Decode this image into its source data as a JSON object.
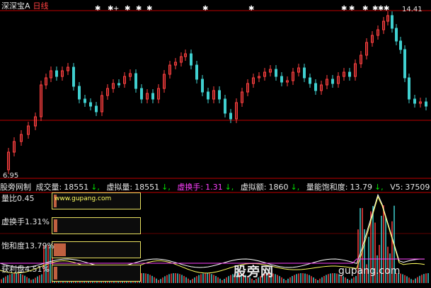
{
  "header": {
    "title": "深深宝A",
    "period": "日线"
  },
  "price": {
    "high_label": "14.41",
    "low_label": "6.95"
  },
  "markers": [
    134,
    152,
    160,
    176,
    192,
    207,
    286,
    351,
    482,
    493,
    512,
    526,
    534,
    542
  ],
  "indicator_bar": {
    "items": [
      {
        "label": "成交量:",
        "value": "18551",
        "arrow": "↓,",
        "color": "white"
      },
      {
        "label": "虚拟量:",
        "value": "18551",
        "arrow": "↓,",
        "color": "white"
      },
      {
        "label": "虚换手:",
        "value": "1.31",
        "arrow": "↓,",
        "color": "magenta"
      },
      {
        "label": "虚拟额:",
        "value": "1860",
        "arrow": "↓,",
        "color": "white"
      },
      {
        "label": "量能饱和度:",
        "value": "13.79",
        "arrow": "↓,",
        "color": "white"
      },
      {
        "label": "V5:",
        "value": "37509",
        "arrow": "↓,",
        "color": "white"
      }
    ],
    "brand": "股旁网制"
  },
  "panels": [
    {
      "label": "量比0.45",
      "fill": 0.03
    },
    {
      "label": "虚换手1.31%",
      "fill": 0.04
    },
    {
      "label": "饱和度13.79%",
      "fill": 0.14
    },
    {
      "label": "获利盘4.51%",
      "fill": 0.04
    }
  ],
  "site_url": "www.gupang.com",
  "watermark": {
    "text": "股旁网",
    "url": "gupang.com"
  },
  "colors": {
    "up": "#ff4040",
    "down": "#40d0d0",
    "ma": "#ffffff",
    "grid": "#c00000",
    "panel_border": "#e8e060"
  }
}
